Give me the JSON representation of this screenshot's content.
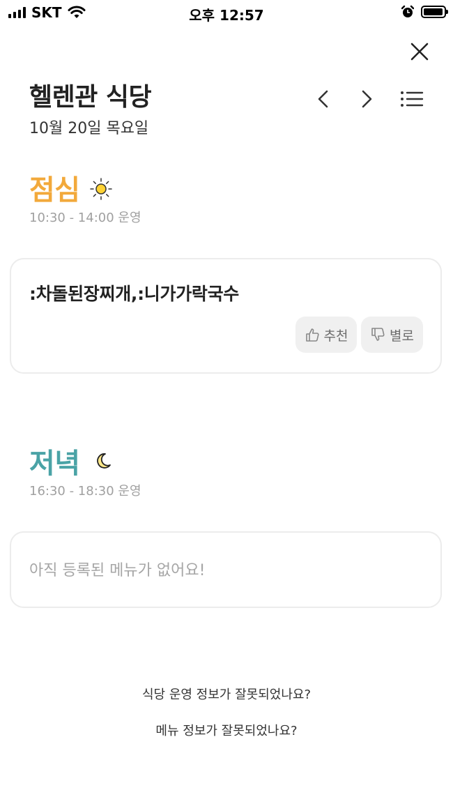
{
  "status_bar": {
    "carrier": "SKT",
    "time": "오후 12:57",
    "battery_level": 0.95
  },
  "header": {
    "title": "헬렌관 식당",
    "date": "10월 20일 목요일",
    "icons": {
      "close": "close-icon",
      "prev": "chevron-left-icon",
      "next": "chevron-right-icon",
      "list": "list-icon"
    }
  },
  "lunch": {
    "title": "점심",
    "icon": "sun-icon",
    "hours": "10:30 - 14:00 운영",
    "menu": ":차돌된장찌개,:니가가락국수",
    "like_label": "추천",
    "dislike_label": "별로",
    "accent": "#F2A93B"
  },
  "dinner": {
    "title": "저녁",
    "icon": "moon-icon",
    "hours": "16:30 - 18:30 운영",
    "empty_message": "아직 등록된 메뉴가 없어요!",
    "accent": "#4AA3A6"
  },
  "footer": {
    "report_hours": "식당 운영 정보가 잘못되었나요?",
    "report_menu": "메뉴 정보가 잘못되었나요?"
  }
}
